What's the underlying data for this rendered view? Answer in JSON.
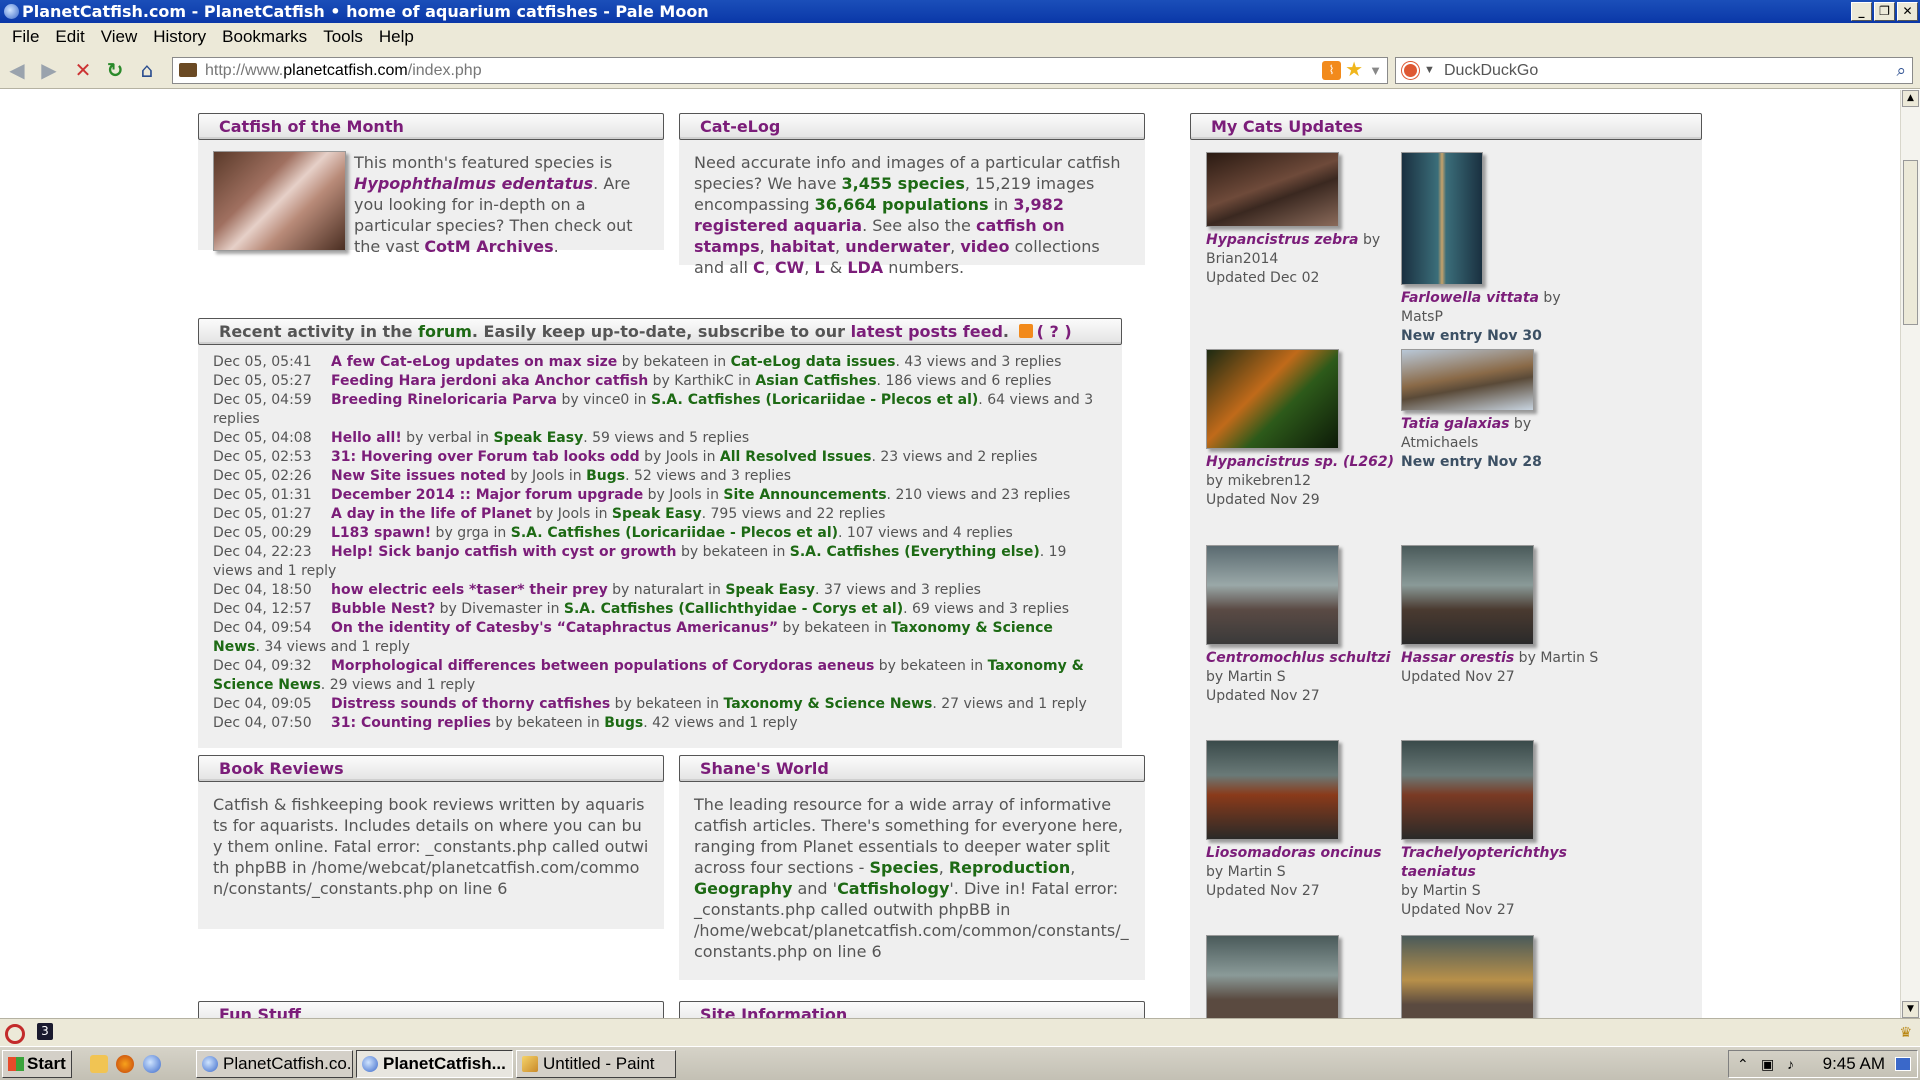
{
  "window": {
    "title": "PlanetCatfish.com - PlanetCatfish • home of aquarium catfishes - Pale Moon",
    "controls": [
      "_",
      "❐",
      "✕"
    ]
  },
  "menu": [
    "File",
    "Edit",
    "View",
    "History",
    "Bookmarks",
    "Tools",
    "Help"
  ],
  "nav": {
    "url_prefix": "http://www.",
    "url_host": "planetcatfish.com",
    "url_path": "/index.php",
    "search_placeholder": "DuckDuckGo"
  },
  "cotm": {
    "title": "Catfish of the Month",
    "text1": "This month's featured species is ",
    "species": "Hypophthalmus edentatus",
    "text2": ". Are you looking for in-depth on a particular species? Then check out the vast ",
    "archive_link": "CotM Archives",
    "text3": "."
  },
  "catelog": {
    "title": "Cat-eLog",
    "t1": "Need accurate info and images of a particular catfish species? We have ",
    "species_count": "3,455 species",
    "t2": ", 15,219 images encompassing ",
    "populations": "36,664 populations",
    "t3": " in ",
    "aquaria": "3,982 registered aquaria",
    "t4": ". See also the ",
    "on_stamps": "catfish on stamps",
    "sep1": ", ",
    "habitat": "habitat",
    "sep2": ", ",
    "underwater": "underwater",
    "sep3": ", ",
    "video": "video",
    "t5": " collections and all ",
    "c": "C",
    "sep4": ", ",
    "cw": "CW",
    "sep5": ", ",
    "l": "L",
    "t6": " & ",
    "lda": "LDA",
    "t7": " numbers."
  },
  "forum": {
    "h1": "Recent activity in the ",
    "forum_link": "forum",
    "h2": ". Easily keep up-to-date, subscribe to our ",
    "feed_link": "latest posts feed",
    "h3": ".",
    "help": "( ? )",
    "by": " by ",
    "in": " in ",
    "posts": [
      {
        "ts": "Dec 05, 05:41",
        "title": "A few Cat-eLog updates on max size",
        "user": "bekateen",
        "forum": "Cat-eLog data issues",
        "stats": ". 43 views and 3 replies"
      },
      {
        "ts": "Dec 05, 05:27",
        "title": "Feeding Hara jerdoni aka Anchor catfish",
        "user": "KarthikC",
        "forum": "Asian Catfishes",
        "stats": ". 186 views and 6 replies"
      },
      {
        "ts": "Dec 05, 04:59",
        "title": "Breeding Rineloricaria Parva",
        "user": "vince0",
        "forum": "S.A. Catfishes (Loricariidae - Plecos et al)",
        "stats": ". 64 views and 3 replies"
      },
      {
        "ts": "Dec 05, 04:08",
        "title": "Hello all!",
        "user": "verbal",
        "forum": "Speak Easy",
        "stats": ". 59 views and 5 replies"
      },
      {
        "ts": "Dec 05, 02:53",
        "title": "31: Hovering over Forum tab looks odd",
        "user": "Jools",
        "forum": "All Resolved Issues",
        "stats": ". 23 views and 2 replies"
      },
      {
        "ts": "Dec 05, 02:26",
        "title": "New Site issues noted",
        "user": "Jools",
        "forum": "Bugs",
        "stats": ". 52 views and 3 replies"
      },
      {
        "ts": "Dec 05, 01:31",
        "title": "December 2014 :: Major forum upgrade",
        "user": "Jools",
        "forum": "Site Announcements",
        "stats": ". 210 views and 23 replies"
      },
      {
        "ts": "Dec 05, 01:27",
        "title": "A day in the life of Planet",
        "user": "Jools",
        "forum": "Speak Easy",
        "stats": ". 795 views and 22 replies"
      },
      {
        "ts": "Dec 05, 00:29",
        "title": "L183 spawn!",
        "user": "grga",
        "forum": "S.A. Catfishes (Loricariidae - Plecos et al)",
        "stats": ". 107 views and 4 replies"
      },
      {
        "ts": "Dec 04, 22:23",
        "title": "Help! Sick banjo catfish with cyst or growth",
        "user": "bekateen",
        "forum": "S.A. Catfishes (Everything else)",
        "stats": ". 19 views and 1 reply"
      },
      {
        "ts": "Dec 04, 18:50",
        "title": "how electric eels *taser* their prey",
        "user": "naturalart",
        "forum": "Speak Easy",
        "stats": ". 37 views and 3 replies"
      },
      {
        "ts": "Dec 04, 12:57",
        "title": "Bubble Nest?",
        "user": "Divemaster",
        "forum": "S.A. Catfishes (Callichthyidae - Corys et al)",
        "stats": ". 69 views and 3 replies"
      },
      {
        "ts": "Dec 04, 09:54",
        "title": "On the identity of Catesby's “Cataphractus Americanus”",
        "user": "bekateen",
        "forum": "Taxonomy & Science News",
        "stats": ". 34 views and 1 reply"
      },
      {
        "ts": "Dec 04, 09:32",
        "title": "Morphological differences between populations of Corydoras aeneus",
        "user": "bekateen",
        "forum": "Taxonomy & Science News",
        "stats": ". 29 views and 1 reply"
      },
      {
        "ts": "Dec 04, 09:05",
        "title": "Distress sounds of thorny catfishes",
        "user": "bekateen",
        "forum": "Taxonomy & Science News",
        "stats": ". 27 views and 1 reply"
      },
      {
        "ts": "Dec 04, 07:50",
        "title": "31: Counting replies",
        "user": "bekateen",
        "forum": "Bugs",
        "stats": ". 42 views and 1 reply"
      }
    ]
  },
  "books": {
    "title": "Book Reviews",
    "text": "Catfish & fishkeeping book reviews written by aquarists for aquarists. Includes details on where you can buy them online. Fatal error: _constants.php called outwith phpBB in /home/webcat/planetcatfish.com/common/constants/_constants.php on line 6"
  },
  "shane": {
    "title": "Shane's World",
    "t1": "The leading resource for a wide array of informative catfish articles. There's something for everyone here, ranging from Planet essentials to deeper water split across four sections - ",
    "species": "Species",
    "sep1": ", ",
    "repro": "Reproduction",
    "sep2": ", ",
    "geo": "Geography",
    "t2": " and '",
    "cfology": "Catfishology",
    "t3": "'. Dive in! Fatal error: _constants.php called outwith phpBB in /home/webcat/planetcatfish.com/common/constants/_constants.php on line 6"
  },
  "fun": {
    "title": "Fun Stuff"
  },
  "siteinfo": {
    "title": "Site Information"
  },
  "mycats": {
    "title": "My Cats Updates",
    "by": " by ",
    "items": [
      {
        "name": "Hypancistrus zebra",
        "user": "Brian2014",
        "status": "Updated Dec 02"
      },
      {
        "name": "Farlowella vittata",
        "user": "MatsP",
        "status": "New entry Nov 30"
      },
      {
        "name": "Hypancistrus sp. (L262)",
        "user": "mikebren12",
        "status": "Updated Nov 29"
      },
      {
        "name": "Tatia galaxias",
        "user": "Atmichaels",
        "status": "New entry Nov 28"
      },
      {
        "name": "Centromochlus schultzi",
        "user": "Martin S",
        "status": "Updated Nov 27"
      },
      {
        "name": "Hassar orestis",
        "user": "Martin S",
        "status": "Updated Nov 27"
      },
      {
        "name": "Liosomadoras oncinus",
        "user": "Martin S",
        "status": "Updated Nov 27"
      },
      {
        "name": "Trachelyopterichthys taeniatus",
        "user": "Martin S",
        "status": "Updated Nov 27"
      }
    ]
  },
  "statusbar": {
    "badge": "3"
  },
  "taskbar": {
    "start": "Start",
    "tasks": [
      "PlanetCatfish.co...",
      "PlanetCatfish...",
      "Untitled - Paint"
    ],
    "clock": "9:45 AM"
  }
}
